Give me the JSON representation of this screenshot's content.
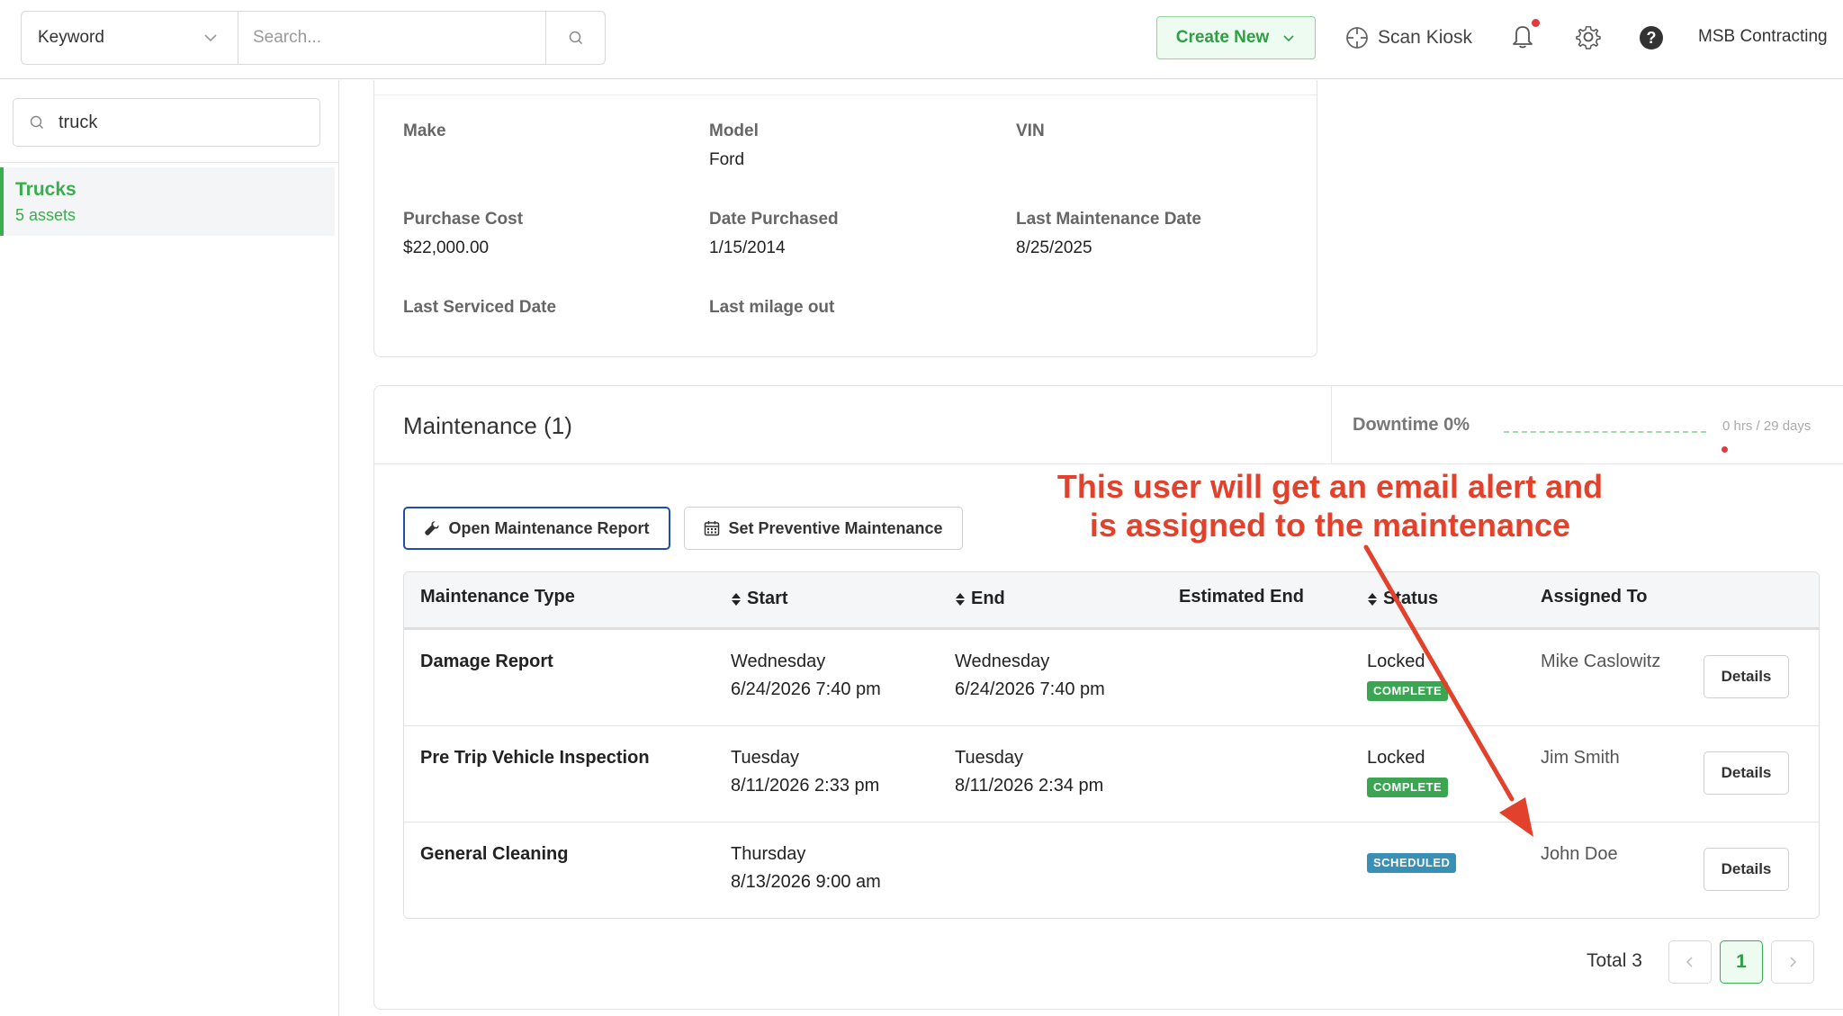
{
  "topbar": {
    "keyword_label": "Keyword",
    "search_placeholder": "Search...",
    "create_new_label": "Create New",
    "scan_kiosk_label": "Scan Kiosk",
    "company_name": "MSB Contracting"
  },
  "sidebar": {
    "search_value": "truck",
    "items": [
      {
        "title": "Trucks",
        "subtitle": "5 assets"
      }
    ]
  },
  "details": {
    "make_label": "Make",
    "make_value": "",
    "model_label": "Model",
    "model_value": "Ford",
    "vin_label": "VIN",
    "vin_value": "",
    "purchase_cost_label": "Purchase Cost",
    "purchase_cost_value": "$22,000.00",
    "date_purchased_label": "Date Purchased",
    "date_purchased_value": "1/15/2014",
    "last_maintenance_label": "Last Maintenance Date",
    "last_maintenance_value": "8/25/2025",
    "last_serviced_label": "Last Serviced Date",
    "last_milage_label": "Last milage out"
  },
  "maintenance": {
    "title": "Maintenance (1)",
    "downtime_label": "Downtime 0%",
    "downtime_meta": "0 hrs / 29 days",
    "downtime_fraction": 0,
    "open_report_label": "Open Maintenance Report",
    "set_preventive_label": "Set Preventive Maintenance",
    "columns": {
      "type": "Maintenance Type",
      "start": "Start",
      "end": "End",
      "estimated_end": "Estimated End",
      "status": "Status",
      "assigned_to": "Assigned To"
    },
    "rows": [
      {
        "type": "Damage Report",
        "start_day": "Wednesday",
        "start_datetime": "6/24/2026 7:40 pm",
        "end_day": "Wednesday",
        "end_datetime": "6/24/2026 7:40 pm",
        "status_text": "Locked",
        "badge": "COMPLETE",
        "assigned_to": "Mike Caslowitz",
        "details_label": "Details"
      },
      {
        "type": "Pre Trip Vehicle Inspection",
        "start_day": "Tuesday",
        "start_datetime": "8/11/2026 2:33 pm",
        "end_day": "Tuesday",
        "end_datetime": "8/11/2026 2:34 pm",
        "status_text": "Locked",
        "badge": "COMPLETE",
        "assigned_to": "Jim Smith",
        "details_label": "Details"
      },
      {
        "type": "General Cleaning",
        "start_day": "Thursday",
        "start_datetime": "8/13/2026 9:00 am",
        "end_day": "",
        "end_datetime": "",
        "status_text": "",
        "badge": "SCHEDULED",
        "assigned_to": "John Doe",
        "details_label": "Details"
      }
    ],
    "pagination": {
      "total_label": "Total 3",
      "current_page": "1"
    }
  },
  "annotation": {
    "line1": "This user will get an email alert and",
    "line2": "is assigned to the maintenance"
  },
  "colors": {
    "accent_green": "#3aad4e",
    "badge_complete": "#3aa652",
    "badge_scheduled": "#3a8fb7",
    "annotation_red": "#e2412b",
    "open_button_border": "#1f4fa8"
  }
}
